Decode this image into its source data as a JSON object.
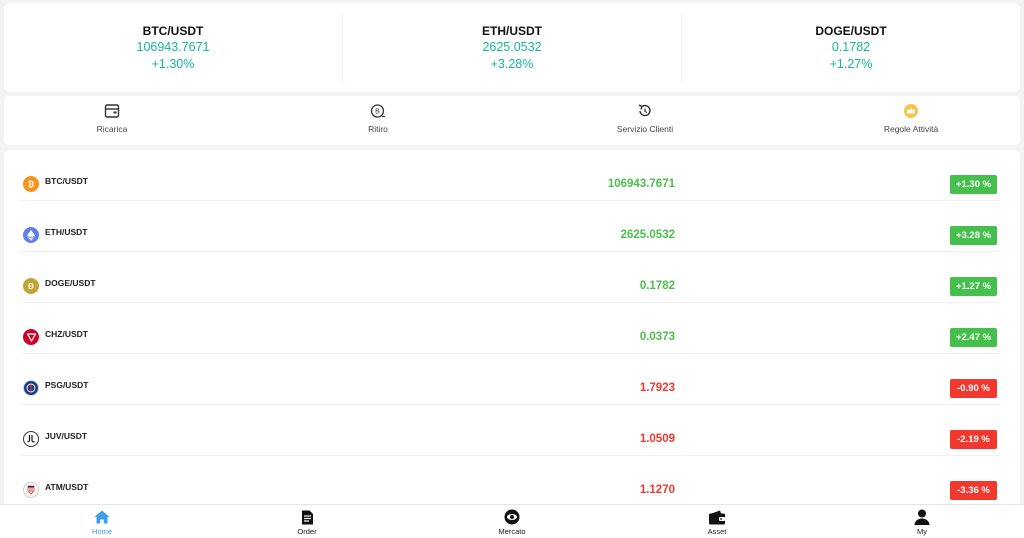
{
  "tickers": [
    {
      "pair": "BTC/USDT",
      "price": "106943.7671",
      "change": "+1.30%"
    },
    {
      "pair": "ETH/USDT",
      "price": "2625.0532",
      "change": "+3.28%"
    },
    {
      "pair": "DOGE/USDT",
      "price": "0.1782",
      "change": "+1.27%"
    }
  ],
  "actions": [
    {
      "label": "Ricarica",
      "icon": "wallet-card-icon"
    },
    {
      "label": "Ritiro",
      "icon": "withdraw-coin-icon"
    },
    {
      "label": "Servizio Clienti",
      "icon": "support-refresh-icon"
    },
    {
      "label": "Regole Attività",
      "icon": "crown-icon"
    }
  ],
  "market": [
    {
      "pair": "BTC/USDT",
      "price": "106943.7671",
      "change": "+1.30 %",
      "trend": "up",
      "icon": "bitcoin-icon",
      "color": "#f7931a"
    },
    {
      "pair": "ETH/USDT",
      "price": "2625.0532",
      "change": "+3.28 %",
      "trend": "up",
      "icon": "ethereum-icon",
      "color": "#627eea"
    },
    {
      "pair": "DOGE/USDT",
      "price": "0.1782",
      "change": "+1.27 %",
      "trend": "up",
      "icon": "dogecoin-icon",
      "color": "#c2a633"
    },
    {
      "pair": "CHZ/USDT",
      "price": "0.0373",
      "change": "+2.47 %",
      "trend": "up",
      "icon": "chiliz-icon",
      "color": "#cd0124"
    },
    {
      "pair": "PSG/USDT",
      "price": "1.7923",
      "change": "-0.90 %",
      "trend": "down",
      "icon": "psg-icon",
      "color": "#1c3b80"
    },
    {
      "pair": "JUV/USDT",
      "price": "1.0509",
      "change": "-2.19 %",
      "trend": "down",
      "icon": "juventus-icon",
      "color": "#ffffff"
    },
    {
      "pair": "ATM/USDT",
      "price": "1.1270",
      "change": "-3.36 %",
      "trend": "down",
      "icon": "atletico-icon",
      "color": "#ffffff"
    }
  ],
  "nav": [
    {
      "label": "Home",
      "icon": "home-icon",
      "active": true
    },
    {
      "label": "Order",
      "icon": "order-document-icon",
      "active": false
    },
    {
      "label": "Mercato",
      "icon": "market-eye-icon",
      "active": false
    },
    {
      "label": "Asset",
      "icon": "wallet-icon",
      "active": false
    },
    {
      "label": "My",
      "icon": "user-icon",
      "active": false
    }
  ],
  "colors": {
    "up": "#45c04c",
    "down": "#f0382e",
    "ticker": "#17b59b",
    "active_nav": "#3aa0e8"
  }
}
